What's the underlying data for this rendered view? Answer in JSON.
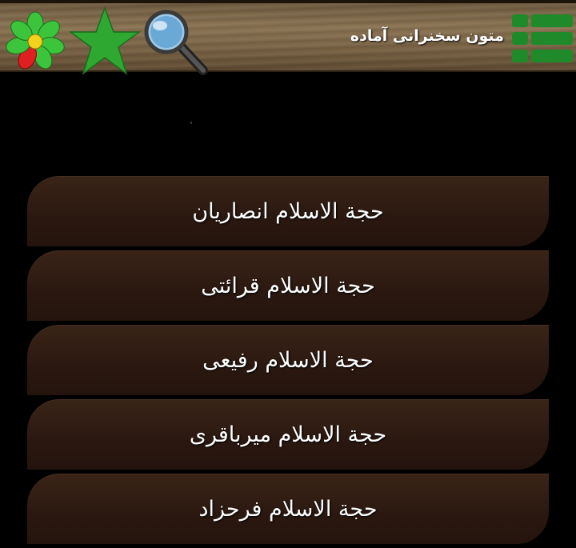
{
  "header": {
    "title": "متون سخنرانی آماده",
    "icons": {
      "menu": "menu-grid-icon",
      "icq": "icq-flower-icon",
      "star": "star-icon",
      "search": "magnifier-search-icon"
    }
  },
  "speakers": [
    {
      "label": "حجة الاسلام انصاريان"
    },
    {
      "label": "حجة الاسلام قرائتی"
    },
    {
      "label": "حجة الاسلام رفيعی"
    },
    {
      "label": "حجة الاسلام ميرباقری"
    },
    {
      "label": "حجة الاسلام فرحزاد"
    }
  ],
  "colors": {
    "background": "#000000",
    "item_background": "#2a1810",
    "star": "#2fa832",
    "menu_icon": "#1f8a2a"
  }
}
